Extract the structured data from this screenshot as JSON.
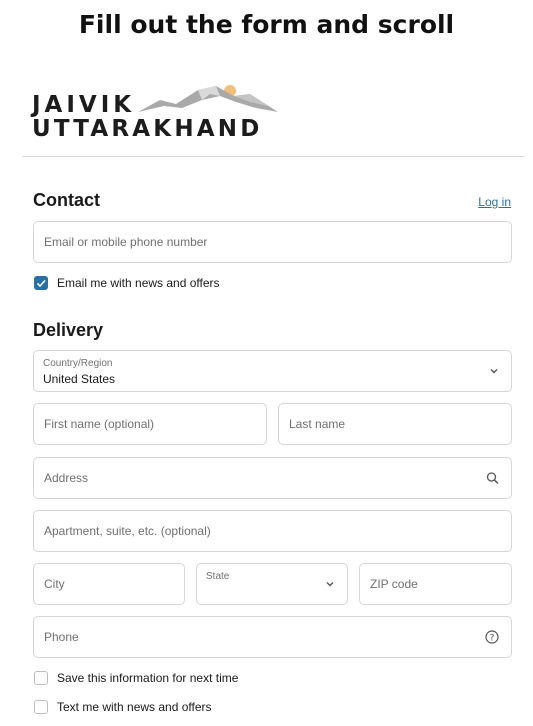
{
  "banner": {
    "text": "Fill out the form and scroll"
  },
  "logo": {
    "line1": "JAIVIK",
    "line2": "UTTARAKHAND"
  },
  "contact": {
    "title": "Contact",
    "login_link": "Log in",
    "email_placeholder": "Email or mobile phone number",
    "news_checkbox": {
      "label": "Email me with news and offers",
      "checked": true
    }
  },
  "delivery": {
    "title": "Delivery",
    "country": {
      "label": "Country/Region",
      "value": "United States"
    },
    "first_name_placeholder": "First name (optional)",
    "last_name_placeholder": "Last name",
    "address_placeholder": "Address",
    "apartment_placeholder": "Apartment, suite, etc. (optional)",
    "city_placeholder": "City",
    "state_label": "State",
    "zip_placeholder": "ZIP code",
    "phone_placeholder": "Phone",
    "save_info_checkbox": {
      "label": "Save this information for next time",
      "checked": false
    },
    "text_news_checkbox": {
      "label": "Text me with news and offers",
      "checked": false
    }
  },
  "colors": {
    "accent": "#2a6fa6",
    "border": "#d6d6d6",
    "placeholder": "#707070"
  }
}
